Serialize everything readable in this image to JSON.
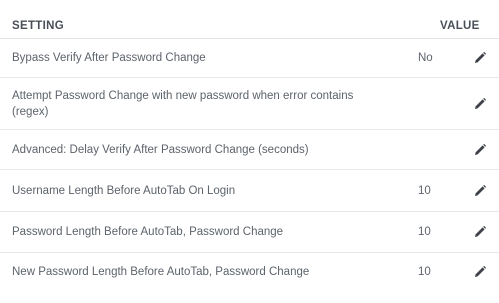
{
  "table": {
    "header_setting": "SETTING",
    "header_value": "VALUE",
    "rows": [
      {
        "setting": "Bypass Verify After Password Change",
        "value": "No"
      },
      {
        "setting": "Attempt Password Change with new password when error contains (regex)",
        "value": ""
      },
      {
        "setting": "Advanced: Delay Verify After Password Change (seconds)",
        "value": ""
      },
      {
        "setting": "Username Length Before AutoTab On Login",
        "value": "10"
      },
      {
        "setting": "Password Length Before AutoTab, Password Change",
        "value": "10"
      },
      {
        "setting": "New Password Length Before AutoTab, Password Change",
        "value": "10"
      }
    ]
  },
  "icons": {
    "edit": "pencil-icon"
  },
  "colors": {
    "text": "#5d636b",
    "header_text": "#4a4f57",
    "divider": "#e6e8eb",
    "icon": "#3d4148"
  }
}
